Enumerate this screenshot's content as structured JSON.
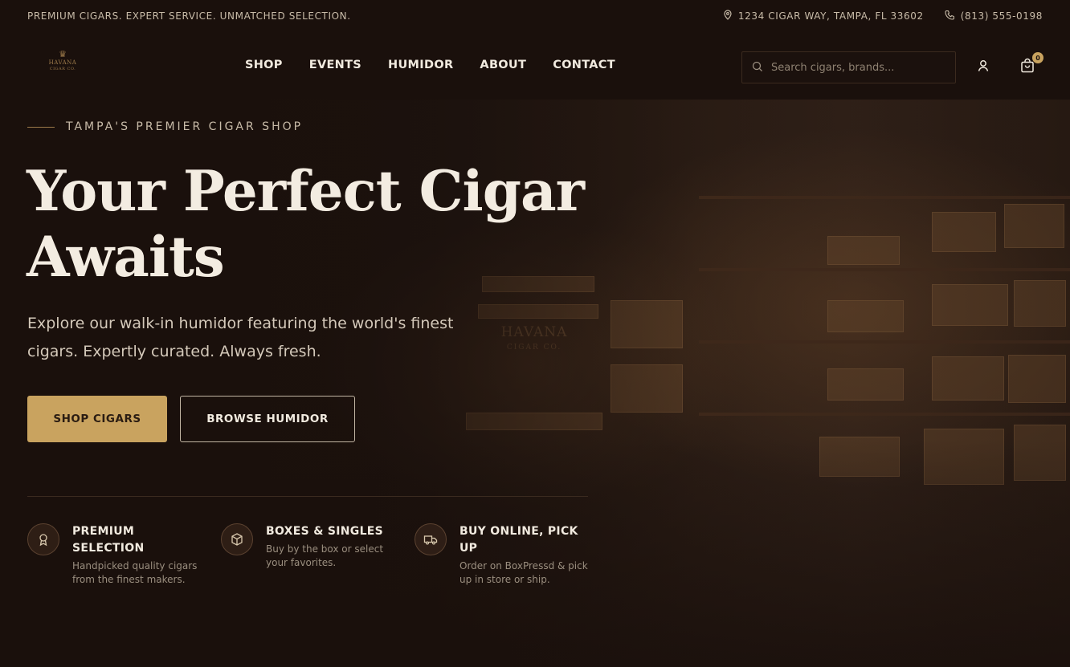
{
  "topbar": {
    "tagline": "PREMIUM CIGARS. EXPERT SERVICE. UNMATCHED SELECTION.",
    "address": "1234 CIGAR WAY, TAMPA, FL 33602",
    "phone": "(813) 555-0198"
  },
  "logo": {
    "name": "HAVANA",
    "sub": "CIGAR CO."
  },
  "nav": {
    "items": [
      "SHOP",
      "EVENTS",
      "HUMIDOR",
      "ABOUT",
      "CONTACT"
    ]
  },
  "search": {
    "placeholder": "Search cigars, brands..."
  },
  "cart": {
    "count": "0"
  },
  "hero": {
    "eyebrow": "TAMPA'S PREMIER CIGAR SHOP",
    "headline_line1": "Your Perfect Cigar",
    "headline_line2": "Awaits",
    "subtext": "Explore our walk-in humidor featuring the world's finest cigars. Expertly curated. Always fresh.",
    "primary_button": "SHOP CIGARS",
    "secondary_button": "BROWSE HUMIDOR",
    "store_sign": "HAVANA",
    "store_sign_sub": "CIGAR CO."
  },
  "features": [
    {
      "icon": "award-icon",
      "title": "PREMIUM SELECTION",
      "desc": "Handpicked quality cigars from the finest makers."
    },
    {
      "icon": "box-icon",
      "title": "BOXES & SINGLES",
      "desc": "Buy by the box or select your favorites."
    },
    {
      "icon": "truck-icon",
      "title": "BUY ONLINE, PICK UP",
      "desc": "Order on BoxPressd & pick up in store or ship."
    }
  ],
  "colors": {
    "background": "#1a100c",
    "accent_gold": "#c9a35f",
    "text_light": "#f3ece1"
  }
}
